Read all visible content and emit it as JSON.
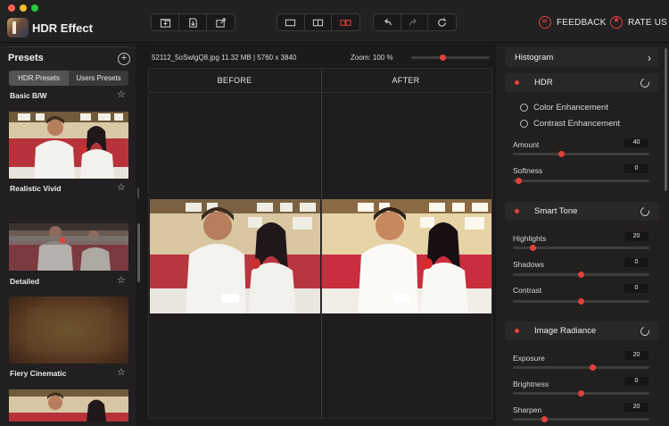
{
  "app": {
    "name": "HDR Effect"
  },
  "toolbar": {
    "group1": [
      "open-file-icon",
      "import-icon",
      "share-icon"
    ],
    "group2": [
      "single-view-icon",
      "split-view-icon",
      "compare-view-icon"
    ],
    "group3": [
      "undo-icon",
      "redo-icon",
      "reset-icon"
    ],
    "feedback_label": "FEEDBACK",
    "rate_label": "RATE US"
  },
  "colors": {
    "accent": "#e2413e",
    "panel": "#221f1f",
    "background": "#1b1a1a"
  },
  "presets": {
    "title": "Presets",
    "tabs": [
      "HDR Presets",
      "Users Presets"
    ],
    "items": [
      {
        "label": "Basic B/W"
      },
      {
        "label": "Realistic Vivid"
      },
      {
        "label": "Detailed"
      },
      {
        "label": "Fiery Cinematic"
      }
    ]
  },
  "file": {
    "info": "52112_5oSwlgQ8.jpg  11.32 MB  |  5760 x 3840",
    "zoom": "Zoom: 100 %",
    "zoom_fraction": 0.4
  },
  "compare": {
    "before": "BEFORE",
    "after": "AFTER"
  },
  "panel": {
    "histogram": "Histogram",
    "hdr": {
      "title": "HDR",
      "options": [
        "Color Enhancement",
        "Contrast Enhancement"
      ],
      "sliders": [
        {
          "label": "Amount",
          "value": "40",
          "fraction": 0.35
        },
        {
          "label": "Softness",
          "value": "0",
          "fraction": 0.02
        }
      ]
    },
    "smart_tone": {
      "title": "Smart Tone",
      "sliders": [
        {
          "label": "Highlights",
          "value": "20",
          "fraction": 0.13
        },
        {
          "label": "Shadows",
          "value": "0",
          "fraction": 0.5
        },
        {
          "label": "Contrast",
          "value": "0",
          "fraction": 0.5
        }
      ]
    },
    "image_radiance": {
      "title": "Image Radiance",
      "sliders": [
        {
          "label": "Exposure",
          "value": "20",
          "fraction": 0.59
        },
        {
          "label": "Brightness",
          "value": "0",
          "fraction": 0.5
        },
        {
          "label": "Sharpen",
          "value": "20",
          "fraction": 0.22
        }
      ]
    }
  }
}
